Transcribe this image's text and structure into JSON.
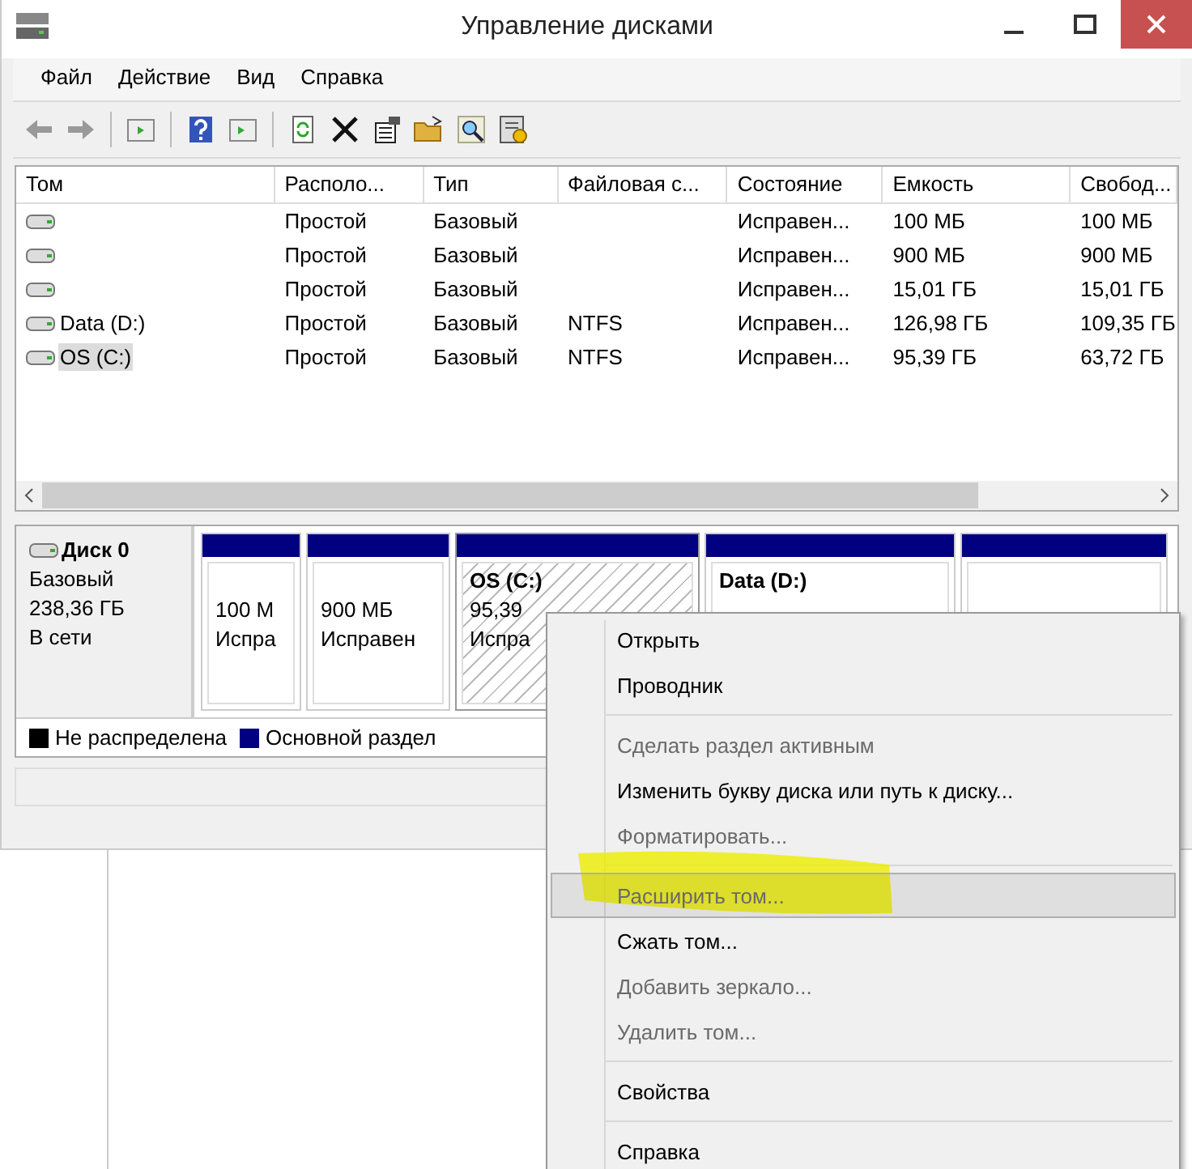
{
  "window": {
    "title": "Управление дисками"
  },
  "menu": [
    "Файл",
    "Действие",
    "Вид",
    "Справка"
  ],
  "table": {
    "columns": [
      "Том",
      "Располо...",
      "Тип",
      "Файловая с...",
      "Состояние",
      "Емкость",
      "Свобод..."
    ],
    "rows": [
      {
        "selected": false,
        "cells": [
          "",
          "Простой",
          "Базовый",
          "",
          "Исправен...",
          "100 МБ",
          "100 МБ"
        ]
      },
      {
        "selected": false,
        "cells": [
          "",
          "Простой",
          "Базовый",
          "",
          "Исправен...",
          "900 МБ",
          "900 МБ"
        ]
      },
      {
        "selected": false,
        "cells": [
          "",
          "Простой",
          "Базовый",
          "",
          "Исправен...",
          "15,01 ГБ",
          "15,01 ГБ"
        ]
      },
      {
        "selected": false,
        "cells": [
          "Data (D:)",
          "Простой",
          "Базовый",
          "NTFS",
          "Исправен...",
          "126,98 ГБ",
          "109,35 ГБ"
        ]
      },
      {
        "selected": true,
        "cells": [
          "OS (C:)",
          "Простой",
          "Базовый",
          "NTFS",
          "Исправен...",
          "95,39 ГБ",
          "63,72 ГБ"
        ]
      }
    ]
  },
  "disk": {
    "name": "Диск 0",
    "lines": [
      "Базовый",
      "238,36 ГБ",
      "В сети"
    ],
    "partitions": [
      {
        "selected": false,
        "lines": [
          "100 М",
          "Испра"
        ]
      },
      {
        "selected": false,
        "lines": [
          "900 МБ",
          "Исправен"
        ]
      },
      {
        "selected": true,
        "title": "OS  (C:)",
        "lines": [
          "95,39",
          "Испра"
        ]
      },
      {
        "selected": false,
        "title": "Data  (D:)"
      },
      {
        "selected": false
      }
    ]
  },
  "legend": [
    {
      "label": "Не распределена",
      "color": "#000000"
    },
    {
      "label": "Основной раздел",
      "color": "#000080"
    }
  ],
  "context_menu": [
    {
      "kind": "item",
      "label": "Открыть",
      "disabled": false,
      "selected": false
    },
    {
      "kind": "item",
      "label": "Проводник",
      "disabled": false,
      "selected": false
    },
    {
      "kind": "separator"
    },
    {
      "kind": "item",
      "label": "Сделать раздел активным",
      "disabled": true,
      "selected": false
    },
    {
      "kind": "item",
      "label": "Изменить букву диска или путь к диску...",
      "disabled": false,
      "selected": false
    },
    {
      "kind": "item",
      "label": "Форматировать...",
      "disabled": true,
      "selected": false
    },
    {
      "kind": "separator"
    },
    {
      "kind": "item",
      "label": "Расширить том...",
      "disabled": true,
      "selected": true
    },
    {
      "kind": "item",
      "label": "Сжать том...",
      "disabled": false,
      "selected": false
    },
    {
      "kind": "item",
      "label": "Добавить зеркало...",
      "disabled": true,
      "selected": false
    },
    {
      "kind": "item",
      "label": "Удалить том...",
      "disabled": true,
      "selected": false
    },
    {
      "kind": "separator"
    },
    {
      "kind": "item",
      "label": "Свойства",
      "disabled": false,
      "selected": false
    },
    {
      "kind": "separator"
    },
    {
      "kind": "item",
      "label": "Справка",
      "disabled": false,
      "selected": false
    }
  ]
}
